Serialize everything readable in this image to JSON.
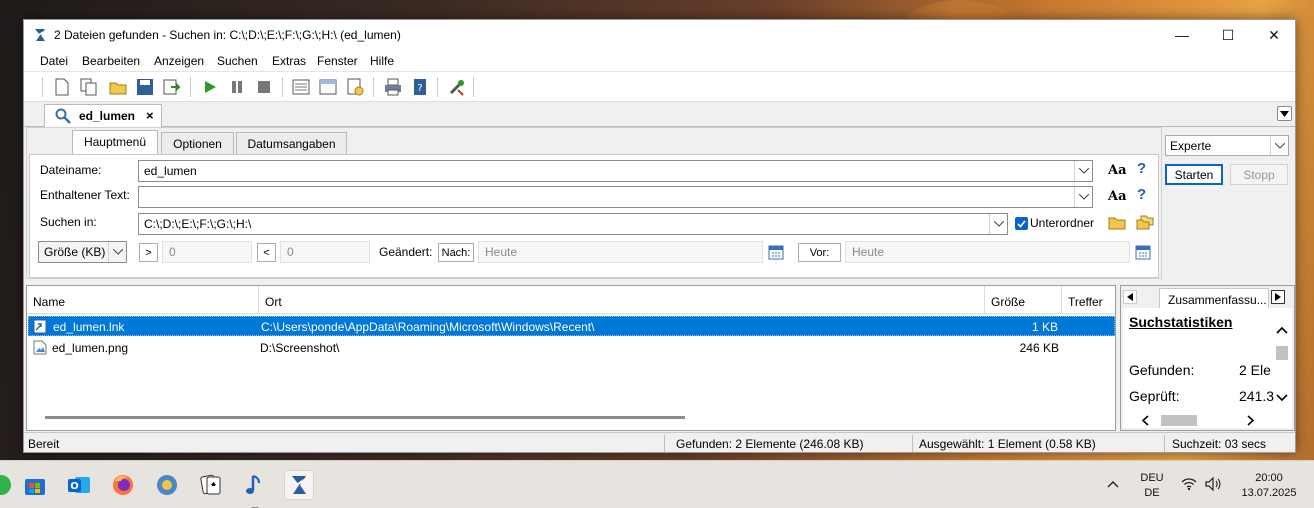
{
  "window": {
    "title": "2 Dateien gefunden - Suchen in: C:\\;D:\\;E:\\;F:\\;G:\\;H:\\ (ed_lumen)",
    "minimize": "—",
    "maximize": "☐",
    "close": "✕"
  },
  "menu": [
    "Datei",
    "Bearbeiten",
    "Anzeigen",
    "Suchen",
    "Extras",
    "Fenster",
    "Hilfe"
  ],
  "doc_tab": {
    "label": "ed_lumen",
    "close": "×"
  },
  "subtabs": [
    "Hauptmenü",
    "Optionen",
    "Datumsangaben"
  ],
  "form": {
    "filename_label": "Dateiname:",
    "filename_value": "ed_lumen",
    "content_label": "Enthaltener Text:",
    "content_value": "",
    "searchin_label": "Suchen in:",
    "searchin_value": "C:\\;D:\\;E:\\;F:\\;G:\\;H:\\",
    "subfolders_label": "Unterordner",
    "aa": "Aa",
    "help": "?",
    "size_mode": "Größe (KB)",
    "gt": ">",
    "gt_value": "0",
    "lt": "<",
    "lt_value": "0",
    "changed_label": "Geändert:",
    "after_label": "Nach:",
    "after_value": "Heute",
    "before_label": "Vor:",
    "before_value": "Heute"
  },
  "right": {
    "mode": "Experte",
    "start": "Starten",
    "stop": "Stopp"
  },
  "columns": [
    "Name",
    "Ort",
    "Größe",
    "Treffer"
  ],
  "rows": [
    {
      "name": "ed_lumen.lnk",
      "location": "C:\\Users\\ponde\\AppData\\Roaming\\Microsoft\\Windows\\Recent\\",
      "size": "1 KB"
    },
    {
      "name": "ed_lumen.png",
      "location": "D:\\Screenshot\\",
      "size": "246 KB"
    }
  ],
  "summary": {
    "tab": "Zusammenfassu...",
    "heading": "Suchstatistiken",
    "found_label": "Gefunden:",
    "found_value": "2 Ele",
    "checked_label": "Geprüft:",
    "checked_value": "241.3"
  },
  "status": {
    "ready": "Bereit",
    "found": "Gefunden: 2 Elemente (246.08 KB)",
    "selected": "Ausgewählt: 1 Element (0.58 KB)",
    "time": "Suchzeit: 03 secs"
  },
  "tray": {
    "lang1": "DEU",
    "lang2": "DE",
    "time": "20:00",
    "date": "13.07.2025",
    "chevron": "^"
  },
  "colors": {
    "selection": "#0078d7",
    "accent": "#1f5fc0"
  }
}
